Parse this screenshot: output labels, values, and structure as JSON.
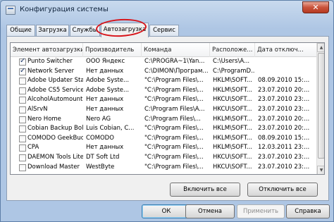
{
  "window": {
    "title": "Конфигурация системы",
    "close_glyph": "✕"
  },
  "tabs": [
    {
      "label": "Общие"
    },
    {
      "label": "Загрузка"
    },
    {
      "label": "Службы"
    },
    {
      "label": "Автозагрузка"
    },
    {
      "label": "Сервис"
    }
  ],
  "table": {
    "columns": [
      "Элемент автозагрузки",
      "Производитель",
      "Команда",
      "Расположе...",
      "Дата отключ..."
    ],
    "rows": [
      {
        "checked": true,
        "name": "Punto Switcher",
        "maker": "ООО Яндекс",
        "command": "C:\\PROGRA~1\\Yan...",
        "location": "C:\\Users\\A...",
        "date": ""
      },
      {
        "checked": true,
        "name": "Network Server",
        "maker": "Нет данных",
        "command": "C:\\DIMON\\Програм...",
        "location": "C:\\ProgramD...",
        "date": ""
      },
      {
        "checked": false,
        "name": "Adobe Updater Sta...",
        "maker": "Adobe Syste...",
        "command": "\"C:\\Program Files\\...",
        "location": "HKLM\\SOFT...",
        "date": "08.09.2010 15:..."
      },
      {
        "checked": false,
        "name": "Adobe CS5 Service...",
        "maker": "Adobe Syste...",
        "command": "\"C:\\Program Files\\...",
        "location": "HKLM\\SOFT...",
        "date": "23.07.2010 20:..."
      },
      {
        "checked": false,
        "name": "AlcoholAutomount",
        "maker": "Нет данных",
        "command": "\"C:\\Program Files\\...",
        "location": "HKCU\\SOFT...",
        "date": "23.07.2010 23:..."
      },
      {
        "checked": false,
        "name": "AlSrvN",
        "maker": "Нет данных",
        "command": "C:\\Program Files\\A...",
        "location": "HKCU\\SOFT...",
        "date": "23.07.2010 23:..."
      },
      {
        "checked": false,
        "name": "Nero Home",
        "maker": "Nero AG",
        "command": "C:\\Program Files\\...",
        "location": "HKLM\\SOFT...",
        "date": "23.07.2010 20:..."
      },
      {
        "checked": false,
        "name": "Cobian Backup Bole...",
        "maker": "Luis Cobian, C...",
        "command": "\"C:\\Program Files\\...",
        "location": "HKLM\\SOFT...",
        "date": "23.07.2010 20:..."
      },
      {
        "checked": false,
        "name": "COMODO GeekBuddy",
        "maker": "COMODO",
        "command": "\"C:\\Program Files\\...",
        "location": "HKLM\\SOFT...",
        "date": "08.09.2010 15:..."
      },
      {
        "checked": false,
        "name": "CPA",
        "maker": "Нет данных",
        "command": "\"C:\\Program Files\\...",
        "location": "HKLM\\SOFT...",
        "date": "12.03.2011 23:..."
      },
      {
        "checked": false,
        "name": "DAEMON Tools Lite",
        "maker": "DT Soft Ltd",
        "command": "\"C:\\Program Files\\...",
        "location": "HKCU\\SOFT...",
        "date": "23.07.2010 23:..."
      },
      {
        "checked": false,
        "name": "Download Master",
        "maker": "WestByte",
        "command": "\"C:\\Program Files\\...",
        "location": "HKCU\\SOFT...",
        "date": "23.07.2010 23:..."
      }
    ]
  },
  "buttons": {
    "enable_all": "Включить все",
    "disable_all": "Отключить все",
    "ok": "ОК",
    "cancel": "Отмена",
    "apply": "Применить",
    "help": "Справка"
  }
}
